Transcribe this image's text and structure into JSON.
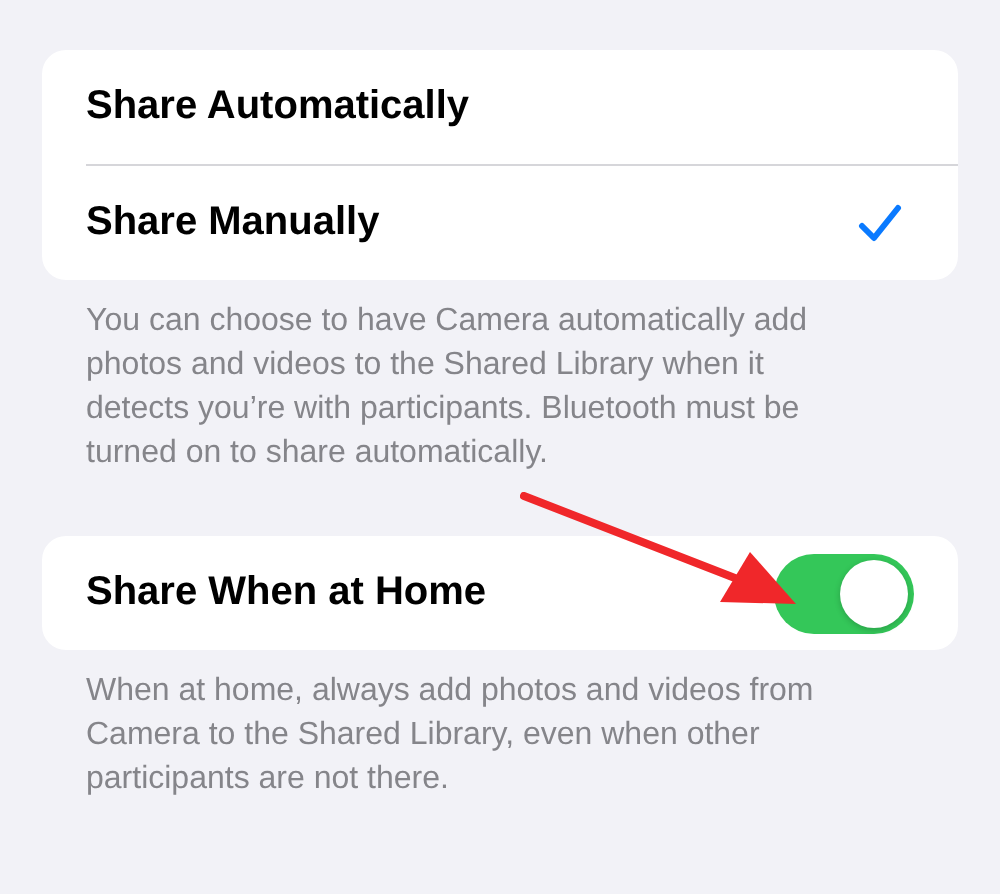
{
  "share_mode": {
    "options": [
      {
        "label": "Share Automatically",
        "selected": false
      },
      {
        "label": "Share Manually",
        "selected": true
      }
    ],
    "footer": "You can choose to have Camera automatically add photos and videos to the Shared Library when it detects you’re with participants. Bluetooth must be turned on to share automatically."
  },
  "home_setting": {
    "label": "Share When at Home",
    "on": true,
    "footer": "When at home, always add photos and videos from Camera to the Shared Library, even when other participants are not there."
  }
}
